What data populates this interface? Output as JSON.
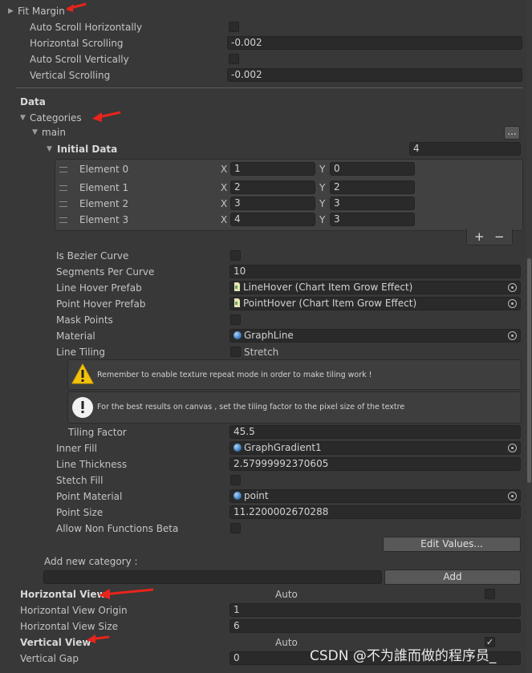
{
  "fit_margin": {
    "title": "Fit Margin",
    "auto_scroll_h_label": "Auto Scroll Horizontally",
    "h_scrolling_label": "Horizontal Scrolling",
    "h_scrolling_value": "-0.002",
    "auto_scroll_v_label": "Auto Scroll Vertically",
    "v_scrolling_label": "Vertical Scrolling",
    "v_scrolling_value": "-0.002"
  },
  "data_section": {
    "title": "Data",
    "categories_label": "Categories",
    "main_label": "main",
    "more_button": "...",
    "initial_data_label": "Initial Data",
    "initial_data_count": "4",
    "x_label": "X",
    "y_label": "Y",
    "elements": [
      {
        "label": "Element 0",
        "x": "1",
        "y": "0"
      },
      {
        "label": "Element 1",
        "x": "2",
        "y": "2"
      },
      {
        "label": "Element 2",
        "x": "3",
        "y": "3"
      },
      {
        "label": "Element 3",
        "x": "4",
        "y": "3"
      }
    ],
    "add_label": "+",
    "remove_label": "−"
  },
  "props": {
    "is_bezier_label": "Is Bezier Curve",
    "segments_label": "Segments Per Curve",
    "segments_value": "10",
    "line_hover_label": "Line Hover Prefab",
    "line_hover_value": "LineHover (Chart Item Grow Effect)",
    "point_hover_label": "Point Hover Prefab",
    "point_hover_value": "PointHover (Chart Item Grow Effect)",
    "mask_points_label": "Mask Points",
    "material_label": "Material",
    "material_value": "GraphLine",
    "line_tiling_label": "Line Tiling",
    "line_tiling_value": "Stretch",
    "warning_text": "Remember to enable texture repeat mode in order to make tiling work !",
    "info_text": "For the best results on canvas , set the tiling factor to the pixel size of the textre",
    "tiling_factor_label": "Tiling Factor",
    "tiling_factor_value": "45.5",
    "inner_fill_label": "Inner Fill",
    "inner_fill_value": "GraphGradient1",
    "line_thickness_label": "Line Thickness",
    "line_thickness_value": "2.57999992370605",
    "stretch_fill_label": "Stetch Fill",
    "point_material_label": "Point Material",
    "point_material_value": "point",
    "point_size_label": "Point Size",
    "point_size_value": "11.2200002670288",
    "allow_non_functions_label": "Allow Non Functions Beta",
    "edit_values_button": "Edit Values...",
    "add_new_category_label": "Add new category :",
    "add_category_value": "",
    "add_button": "Add"
  },
  "horizontal_view": {
    "title": "Horizontal View",
    "auto_label": "Auto",
    "origin_label": "Horizontal View Origin",
    "origin_value": "1",
    "size_label": "Horizontal View Size",
    "size_value": "6"
  },
  "vertical_view": {
    "title": "Vertical View",
    "auto_label": "Auto",
    "gap_label": "Vertical Gap",
    "gap_value": "0"
  },
  "watermark": "CSDN @不为誰而做的程序员_",
  "colors": {
    "background": "#383838",
    "field": "#2a2a2a",
    "annotation_arrow": "#e8241c",
    "warning": "#f4c20d"
  },
  "icons": [
    "warning-icon",
    "info-icon",
    "object-picker-icon",
    "prefab-icon",
    "material-icon",
    "checkmark-icon"
  ]
}
